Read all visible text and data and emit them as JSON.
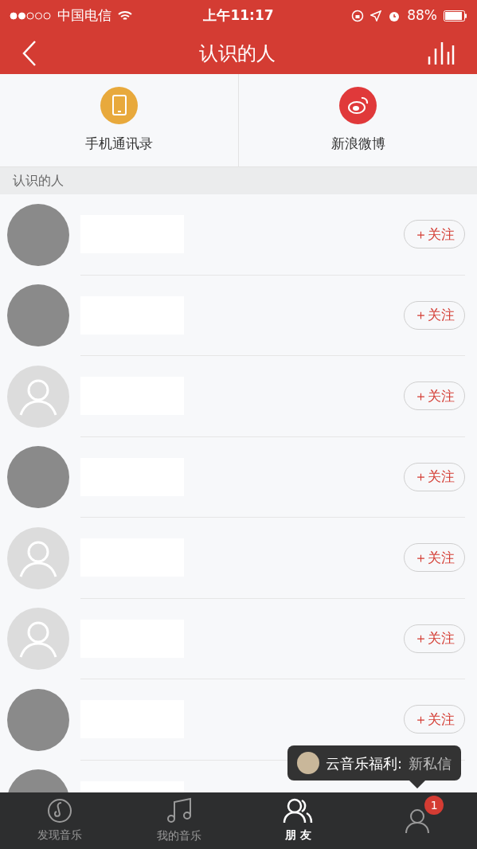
{
  "status_bar": {
    "carrier": "中国电信",
    "time": "上午11:17",
    "battery": "88%"
  },
  "nav": {
    "title": "认识的人"
  },
  "sources": [
    {
      "kind": "phone",
      "label": "手机通讯录",
      "color": "#e8a93c"
    },
    {
      "kind": "weibo",
      "label": "新浪微博",
      "color": "#e0393a"
    }
  ],
  "section": {
    "title": "认识的人"
  },
  "people": [
    {
      "kind": "photo",
      "follow": "＋关注"
    },
    {
      "kind": "photo",
      "follow": "＋关注"
    },
    {
      "kind": "default",
      "follow": "＋关注"
    },
    {
      "kind": "photo",
      "follow": "＋关注"
    },
    {
      "kind": "default",
      "follow": "＋关注"
    },
    {
      "kind": "default",
      "follow": "＋关注"
    },
    {
      "kind": "photo",
      "follow": "＋关注"
    },
    {
      "kind": "photo"
    }
  ],
  "tooltip": {
    "sender": "云音乐福利:",
    "message": "新私信"
  },
  "tab_bar": [
    {
      "kind": "discover",
      "label": "发现音乐",
      "selected": false
    },
    {
      "kind": "music",
      "label": "我的音乐",
      "selected": false
    },
    {
      "kind": "friends",
      "label": "朋 友",
      "selected": true
    },
    {
      "kind": "account",
      "selected": false,
      "badge": "1"
    }
  ]
}
